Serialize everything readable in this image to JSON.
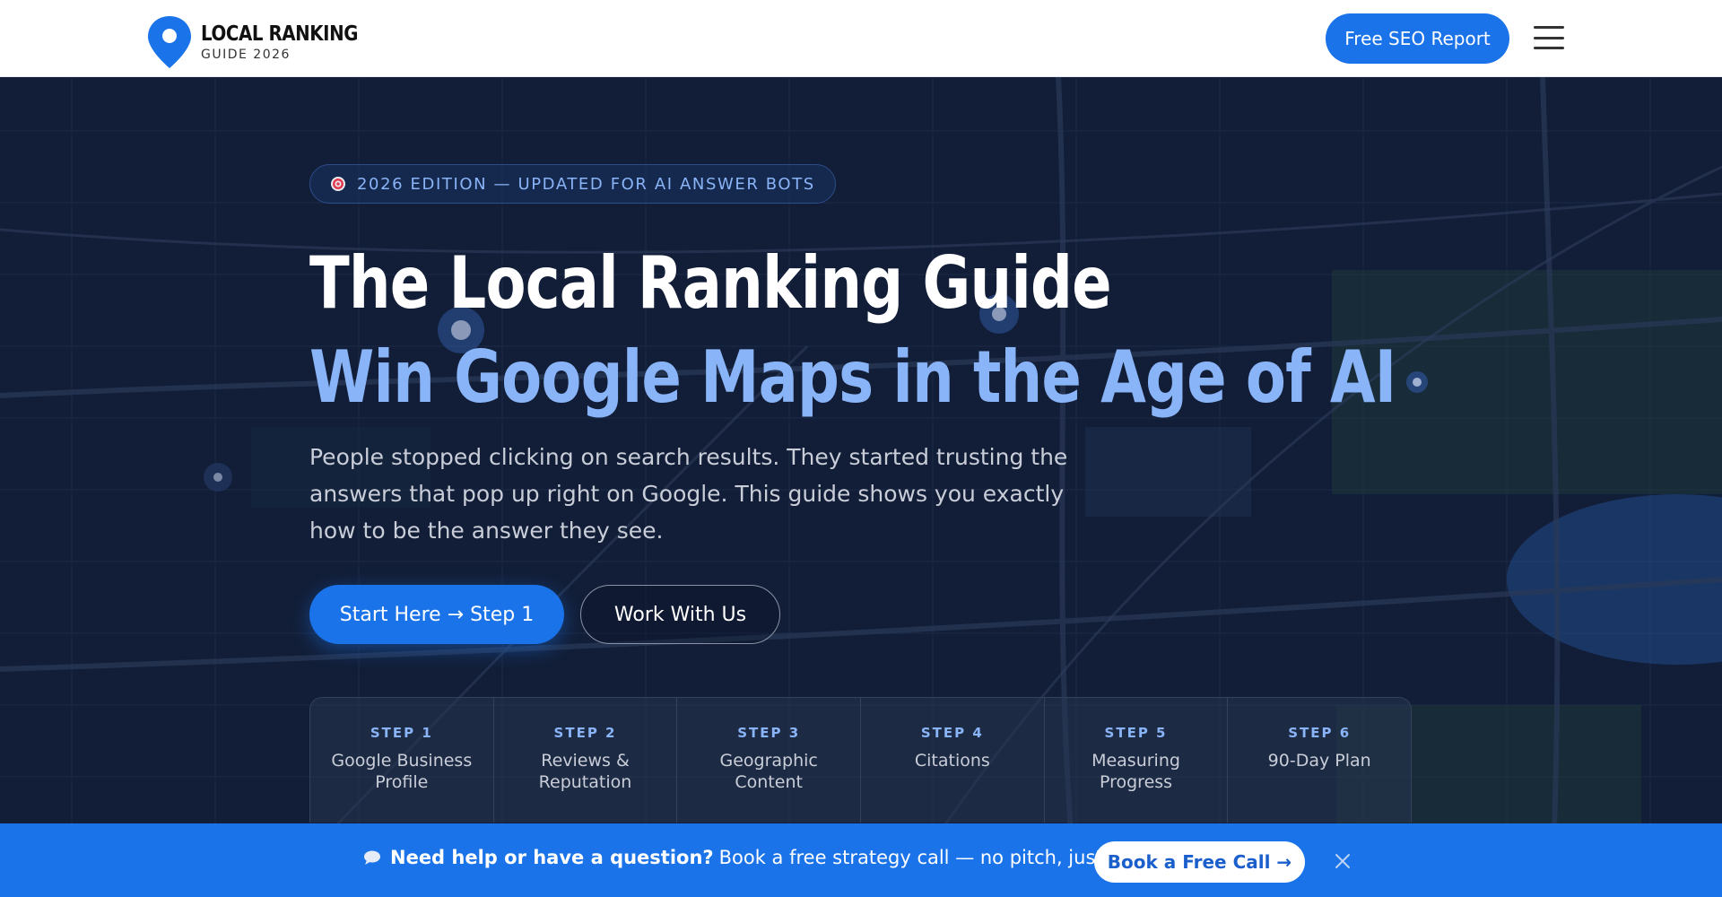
{
  "header": {
    "logo_title": "LOCAL RANKING",
    "logo_subtitle": "GUIDE 2026",
    "cta_label": "Free SEO Report",
    "menu_icon": "hamburger-menu-icon"
  },
  "hero": {
    "badge_icon": "target-icon",
    "badge_text": "2026 EDITION — UPDATED FOR AI ANSWER BOTS",
    "title_line1": "The Local Ranking Guide",
    "title_line2": "Win Google Maps in the Age of AI",
    "description": "People stopped clicking on search results. They started trusting the answers that pop up right on Google. This guide shows you exactly how to be the answer they see.",
    "primary_button": "Start Here → Step 1",
    "secondary_button": "Work With Us"
  },
  "steps": [
    {
      "num": "STEP 1",
      "title": "Google Business Profile"
    },
    {
      "num": "STEP 2",
      "title": "Reviews & Reputation"
    },
    {
      "num": "STEP 3",
      "title": "Geographic Content"
    },
    {
      "num": "STEP 4",
      "title": "Citations"
    },
    {
      "num": "STEP 5",
      "title": "Measuring Progress"
    },
    {
      "num": "STEP 6",
      "title": "90-Day Plan"
    }
  ],
  "cta_bar": {
    "icon": "chat-bubble-icon",
    "question": "Need help or have a question?",
    "message": "Book a free strategy call — no pitch, just answers.",
    "button": "Book a Free Call →",
    "close_icon": "close-icon"
  },
  "colors": {
    "accent": "#1a73e8",
    "hero_bg": "#121e37",
    "highlight": "#8ab4f8"
  }
}
